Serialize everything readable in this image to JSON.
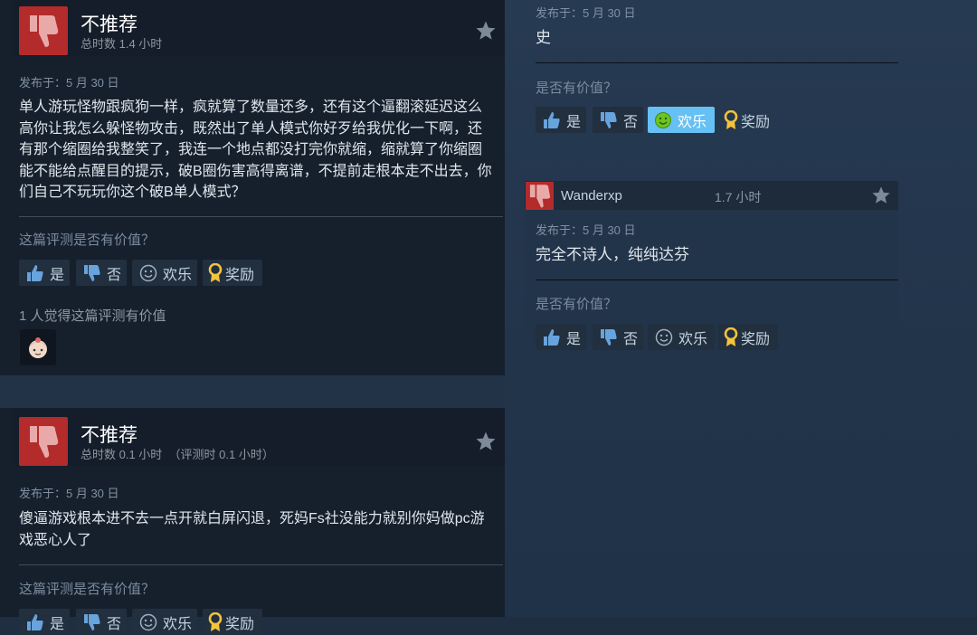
{
  "review1": {
    "title": "不推荐",
    "hours": "总时数 1.4 小时",
    "date": "发布于：5 月 30 日",
    "body": "单人游玩怪物跟疯狗一样，疯就算了数量还多，还有这个逼翻滚延迟这么高你让我怎么躲怪物攻击，既然出了单人模式你好歹给我优化一下啊，还有那个缩圈给我整笑了，我连一个地点都没打完你就缩，缩就算了你缩圈能不能给点醒目的提示，破B圈伤害高得离谱，不提前走根本走不出去，你们自己不玩玩你这个破B单人模式？",
    "question": "这篇评测是否有价值？",
    "helpful_count": "1 人觉得这篇评测有价值"
  },
  "review2": {
    "title": "不推荐",
    "hours": "总时数 0.1 小时  （评测时 0.1 小时）",
    "date": "发布于：5 月 30 日",
    "body": "傻逼游戏根本进不去一点开就白屏闪退，死妈Fs社没能力就别你妈做pc游戏恶心人了",
    "question": "这篇评测是否有价值？"
  },
  "comment1": {
    "date": "发布于：5 月 30 日",
    "body": "史",
    "question": "是否有价值？"
  },
  "comment2": {
    "username": "Wanderxp",
    "hours": "1.7 小时",
    "date": "发布于：5 月 30 日",
    "body": "完全不诗人，纯纯达芬",
    "question": "是否有价值？"
  },
  "buttons": {
    "yes": "是",
    "no": "否",
    "funny": "欢乐",
    "award": "奖励"
  },
  "icons": {
    "thumbs_down": "thumbs-down-icon",
    "star": "star-icon",
    "award": "award-ribbon-icon",
    "funny": "smiley-icon"
  },
  "colors": {
    "not_recommended": "#b32b2b",
    "funny_active": "#66c0f4",
    "award_gold": "#f3c33c"
  }
}
